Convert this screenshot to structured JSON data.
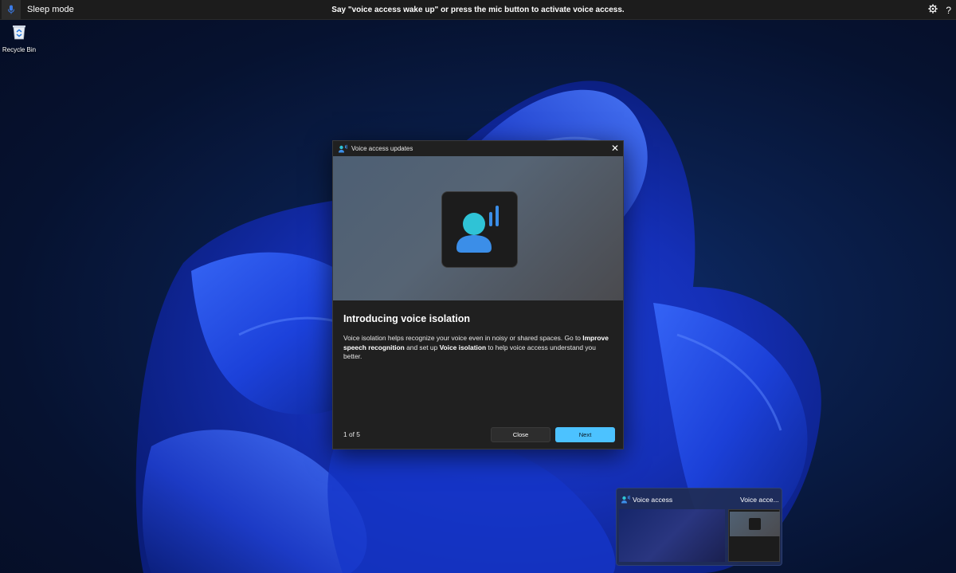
{
  "topbar": {
    "mode_label": "Sleep mode",
    "message": "Say \"voice access wake up\" or press the mic button to activate voice access.",
    "help_label": "?"
  },
  "desktop": {
    "icons": [
      {
        "label": "Recycle Bin",
        "icon": "recycle-bin-icon"
      }
    ]
  },
  "dialog": {
    "title": "Voice access updates",
    "close_glyph": "✕",
    "heading": "Introducing voice isolation",
    "body": {
      "part1": "Voice isolation helps recognize your voice even in noisy or shared spaces. Go to ",
      "bold1": "Improve speech recognition",
      "part2": " and set up ",
      "bold2": "Voice isolation",
      "part3": " to help voice access understand you better."
    },
    "page_indicator": "1 of 5",
    "close_button": "Close",
    "next_button": "Next"
  },
  "taskbar_preview": {
    "left_title": "Voice access",
    "right_title": "Voice acce..."
  },
  "colors": {
    "accent": "#4cc2ff",
    "dialog_bg": "#202020",
    "topbar_bg": "#1c1c1c",
    "icon_teal": "#2fc3d6",
    "icon_blue": "#3b8ee8"
  }
}
